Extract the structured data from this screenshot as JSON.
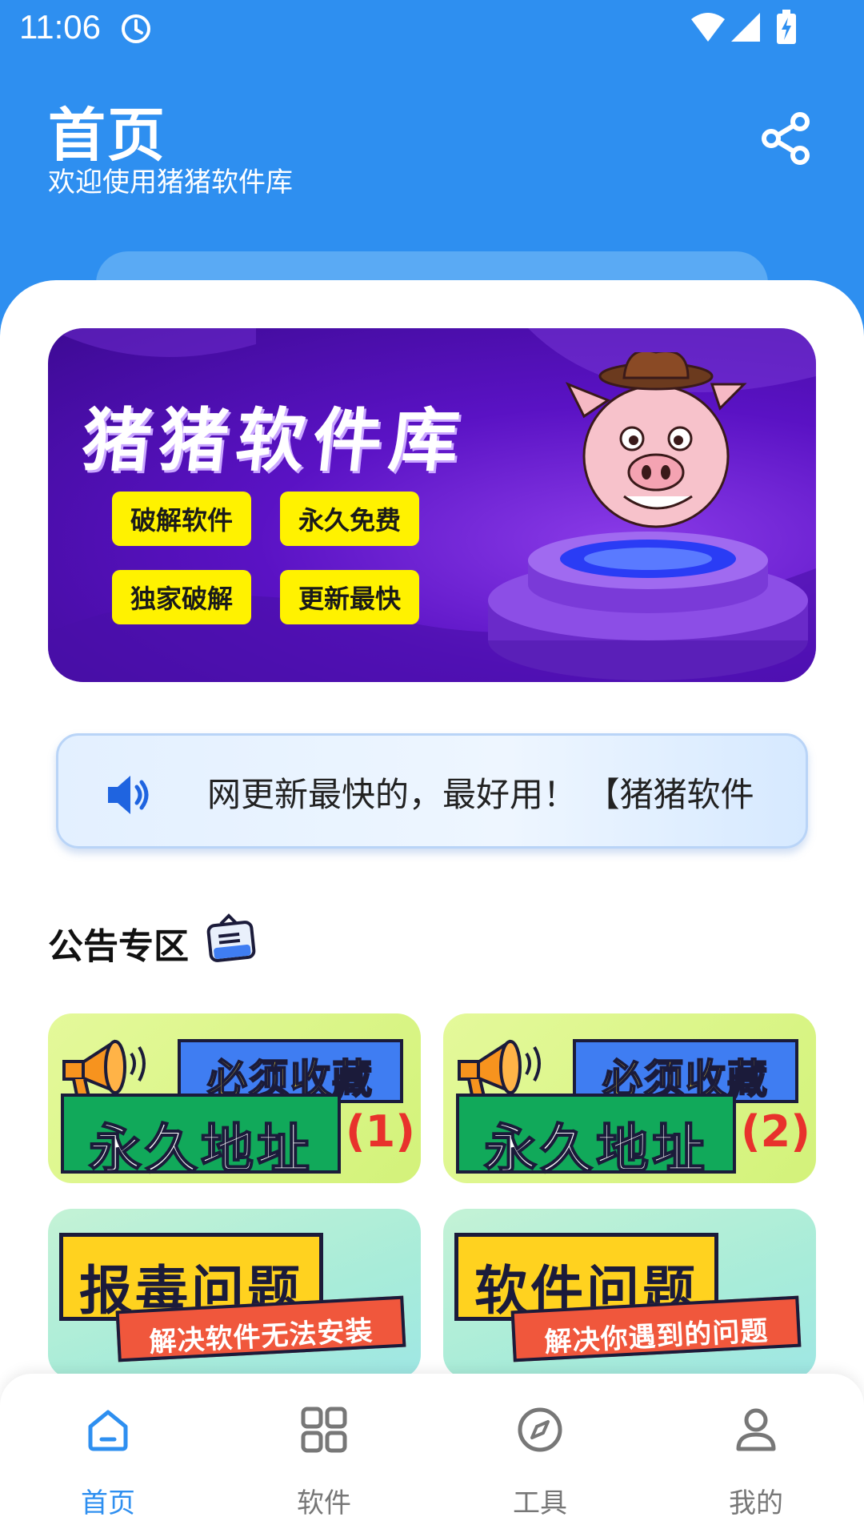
{
  "status_bar": {
    "time": "11:06"
  },
  "header": {
    "title": "首页",
    "subtitle": "欢迎使用猪猪软件库"
  },
  "banner": {
    "title": "猪猪软件库",
    "tags": [
      "破解软件",
      "永久免费",
      "独家破解",
      "更新最快"
    ]
  },
  "notice": {
    "text": "网更新最快的，最好用！    【猪猪软件"
  },
  "announcements": {
    "title": "公告专区",
    "cards": [
      {
        "top": "必须收藏",
        "main": "永久地址",
        "num": "(1)"
      },
      {
        "top": "必须收藏",
        "main": "永久地址",
        "num": "(2)"
      },
      {
        "main": "报毒问题",
        "sub": "解决软件无法安装"
      },
      {
        "main": "软件问题",
        "sub": "解决你遇到的问题"
      }
    ]
  },
  "bottom_nav": {
    "items": [
      {
        "label": "首页",
        "icon": "home-icon",
        "active": true
      },
      {
        "label": "软件",
        "icon": "grid-icon",
        "active": false
      },
      {
        "label": "工具",
        "icon": "compass-icon",
        "active": false
      },
      {
        "label": "我的",
        "icon": "user-icon",
        "active": false
      }
    ]
  },
  "colors": {
    "primary": "#2e8ff0",
    "nav_inactive": "#777777",
    "tag_yellow": "#fff200"
  }
}
